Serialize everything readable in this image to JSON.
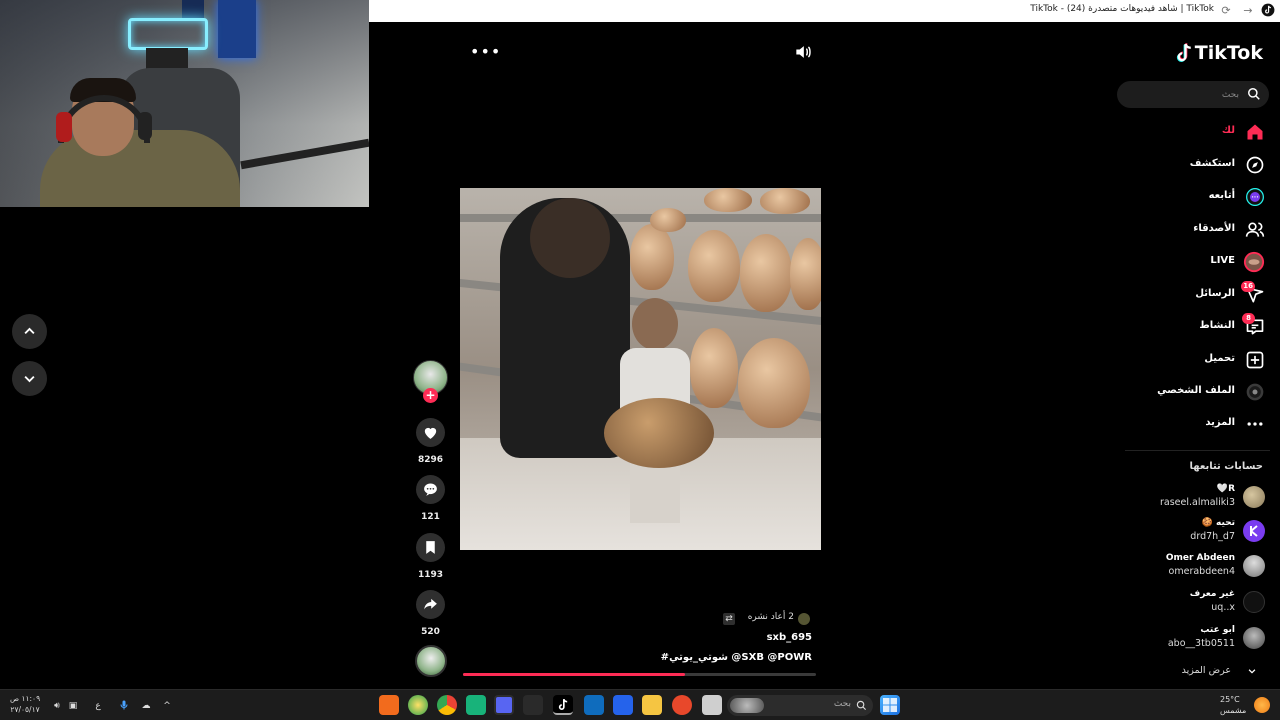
{
  "browser": {
    "tab_title": "TikTok | شاهد فيديوهات متصدرة (24) - TikTok"
  },
  "sidebar": {
    "logo": "TikTok",
    "search_placeholder": "بحث",
    "items": [
      {
        "label": "لك",
        "icon": "home-icon",
        "active": true
      },
      {
        "label": "استكشف",
        "icon": "compass-icon"
      },
      {
        "label": "أتابعه",
        "icon": "following-icon"
      },
      {
        "label": "الأصدقاء",
        "icon": "friends-icon"
      },
      {
        "label": "LIVE",
        "icon": "live-icon"
      },
      {
        "label": "الرسائل",
        "icon": "messages-icon",
        "badge": "16"
      },
      {
        "label": "النشاط",
        "icon": "activity-icon",
        "badge": "8"
      },
      {
        "label": "تحميل",
        "icon": "upload-icon"
      },
      {
        "label": "الملف الشخصي",
        "icon": "profile-icon"
      },
      {
        "label": "المزيد",
        "icon": "more-icon"
      }
    ],
    "following_title": "حسابات تتابعها",
    "accounts": [
      {
        "name": "R🤍",
        "handle": "raseel.almaliki3",
        "color": "#8a7a5a"
      },
      {
        "name": "تحيه 🍪",
        "handle": "drd7h_d7",
        "color": "#7a3cf0"
      },
      {
        "name": "Omer Abdeen",
        "handle": "omerabdeen4",
        "color": "#9a9a9a"
      },
      {
        "name": "غير معرف",
        "handle": "uq..x",
        "color": "#1a1a1a"
      },
      {
        "name": "ابو عتب",
        "handle": "abo__3tb0511",
        "color": "#6a6a6a"
      }
    ],
    "see_more": "عرض المزيد"
  },
  "video": {
    "likes": "8296",
    "comments": "121",
    "saves": "1193",
    "shares": "520",
    "repost_text": "2 أعاد نشره",
    "author": "sxb_695",
    "caption": "#شوتي_يوتي @SXB  @POWR",
    "progress": 0.63
  },
  "taskbar": {
    "search_label": "بحث",
    "time": "١١:٠٩ ص",
    "date": "٢٧/٠٥/١٧",
    "lang": "ع",
    "temp": "25°C",
    "weather": "مشمس"
  },
  "colors": {
    "accent": "#fe2c55",
    "background": "#000000"
  }
}
